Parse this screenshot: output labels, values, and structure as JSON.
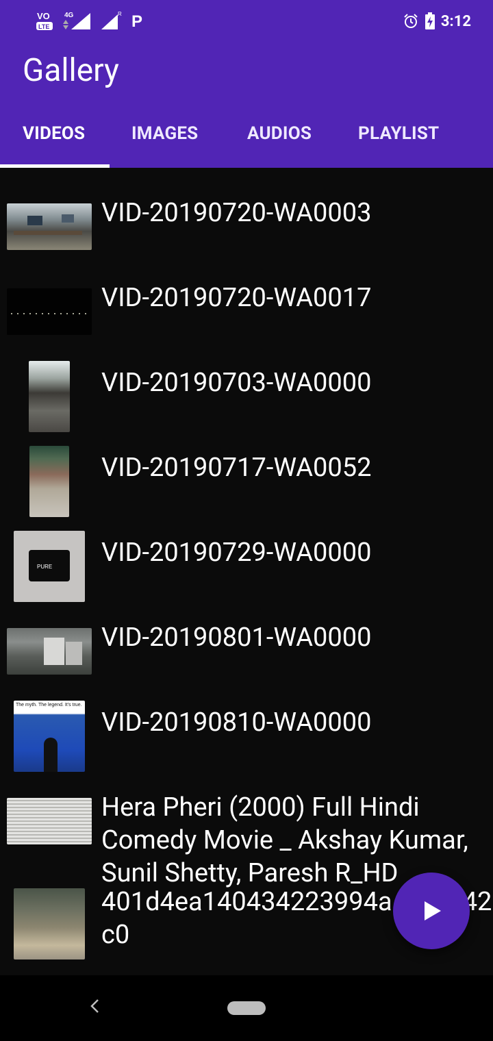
{
  "status_bar": {
    "left_icons": [
      "volte-icon",
      "4g-signal-icon",
      "signal-r-icon",
      "p-icon"
    ],
    "time": "3:12",
    "volte_label": "VO LTE",
    "network": "4G"
  },
  "appbar": {
    "title": "Gallery",
    "tabs": [
      {
        "label": "VIDEOS",
        "selected": true
      },
      {
        "label": "IMAGES",
        "selected": false
      },
      {
        "label": "AUDIOS",
        "selected": false
      },
      {
        "label": "PLAYLIST",
        "selected": false
      }
    ]
  },
  "videos": [
    {
      "name": "VID-20190720-WA0003"
    },
    {
      "name": "VID-20190720-WA0017"
    },
    {
      "name": "VID-20190703-WA0000"
    },
    {
      "name": "VID-20190717-WA0052"
    },
    {
      "name": "VID-20190729-WA0000"
    },
    {
      "name": "VID-20190801-WA0000"
    },
    {
      "name": "VID-20190810-WA0000"
    },
    {
      "name": "Hera Pheri (2000) Full Hindi Comedy Movie _ Akshay Kumar, Sunil Shetty, Paresh R_HD"
    },
    {
      "name": "401d4ea140434223994a    e0 3742c0"
    }
  ],
  "thumbnails": {
    "t5_text": "PURE",
    "t7_text": "The myth. The legend. It's true."
  },
  "fab": {
    "icon": "play-icon"
  },
  "nav_bar": {
    "icons": [
      "back-icon",
      "home-pill-icon"
    ]
  },
  "colors": {
    "primary": "#5125b5",
    "background": "#0b0b0b",
    "indicator": "#ffffff"
  }
}
